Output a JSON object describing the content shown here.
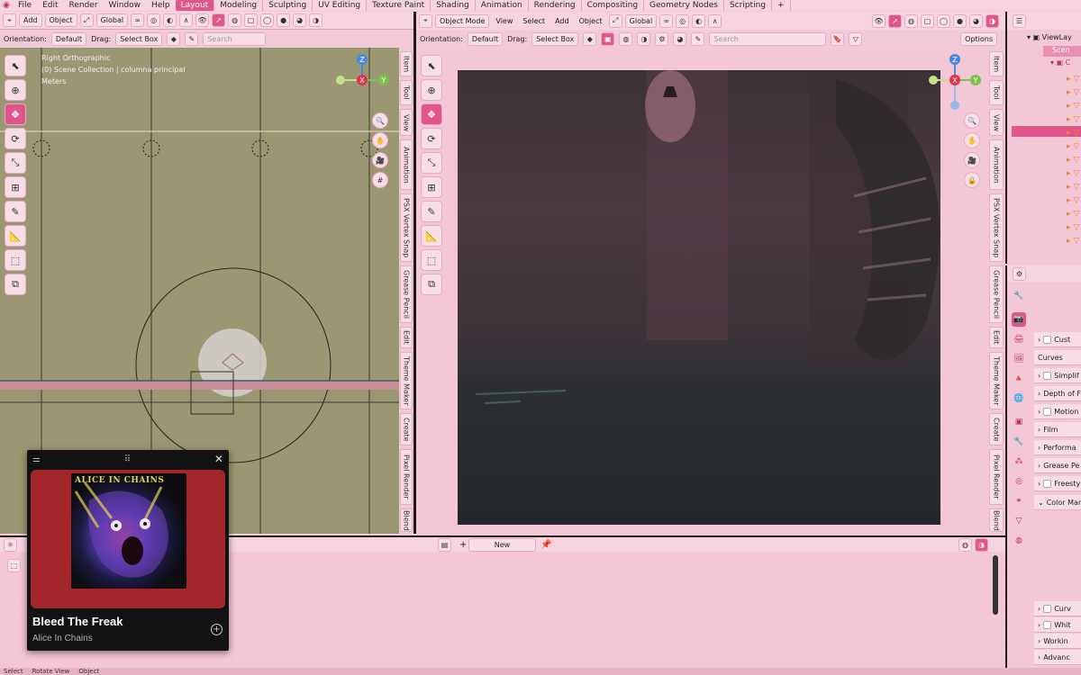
{
  "topbar": {
    "menus": [
      "File",
      "Edit",
      "Render",
      "Window",
      "Help"
    ],
    "workspaces": [
      "Layout",
      "Modeling",
      "Sculpting",
      "UV Editing",
      "Texture Paint",
      "Shading",
      "Animation",
      "Rendering",
      "Compositing",
      "Geometry Nodes",
      "Scripting"
    ],
    "active_workspace": "Layout"
  },
  "left_view": {
    "header": {
      "add": "Add",
      "object": "Object",
      "transform_space": "Global"
    },
    "sub": {
      "orientation_label": "Orientation:",
      "orientation_value": "Default",
      "drag_label": "Drag:",
      "drag_value": "Select Box",
      "search_placeholder": "Search"
    },
    "info": {
      "view_name": "Right Orthographic",
      "collection": "(0) Scene Collection | columna principal",
      "units": "Meters"
    },
    "side_tabs": [
      "Item",
      "Tool",
      "View",
      "Animation",
      "PSX Vertex Snap",
      "Grease Pencil",
      "Edit",
      "Theme Maker",
      "Create",
      "Pixel Render",
      "Blend"
    ],
    "axis": {
      "x": "X",
      "y": "Y",
      "z": "Z"
    }
  },
  "right_view": {
    "header": {
      "mode": "Object Mode",
      "view": "View",
      "select": "Select",
      "add": "Add",
      "object": "Object",
      "transform_space": "Global"
    },
    "sub": {
      "orientation_label": "Orientation:",
      "orientation_value": "Default",
      "drag_label": "Drag:",
      "drag_value": "Select Box",
      "search_placeholder": "Search",
      "options": "Options"
    },
    "side_tabs": [
      "Item",
      "Tool",
      "View",
      "Animation",
      "PSX Vertex Snap",
      "Grease Pencil",
      "Edit",
      "Theme Maker",
      "Create",
      "Pixel Render",
      "Blend"
    ],
    "axis": {
      "x": "X",
      "y": "Y",
      "z": "Z"
    }
  },
  "outliner": {
    "view_layer": "ViewLay",
    "scene": "Scen"
  },
  "properties": {
    "rows": [
      "Cust",
      "Curves",
      "Simplif",
      "Depth of F",
      "Motion",
      "Film",
      "Performa",
      "Grease Pe",
      "Freesty",
      "Color Man",
      "Curv",
      "Whit",
      "Workin",
      "Advanc"
    ]
  },
  "bottom": {
    "new_button": "New"
  },
  "statusbar": {
    "items": [
      "Select",
      "Rotate View",
      "Object"
    ]
  },
  "player": {
    "track": "Bleed The Freak",
    "artist": "Alice In Chains",
    "cover_text": "ALICE IN CHAINS"
  },
  "colors": {
    "accent": "#e0558a",
    "ui_bg": "#f4c7d6",
    "viewport_ortho": "#9b9772",
    "player_bg": "#121212",
    "album_bg": "#a3262a"
  }
}
